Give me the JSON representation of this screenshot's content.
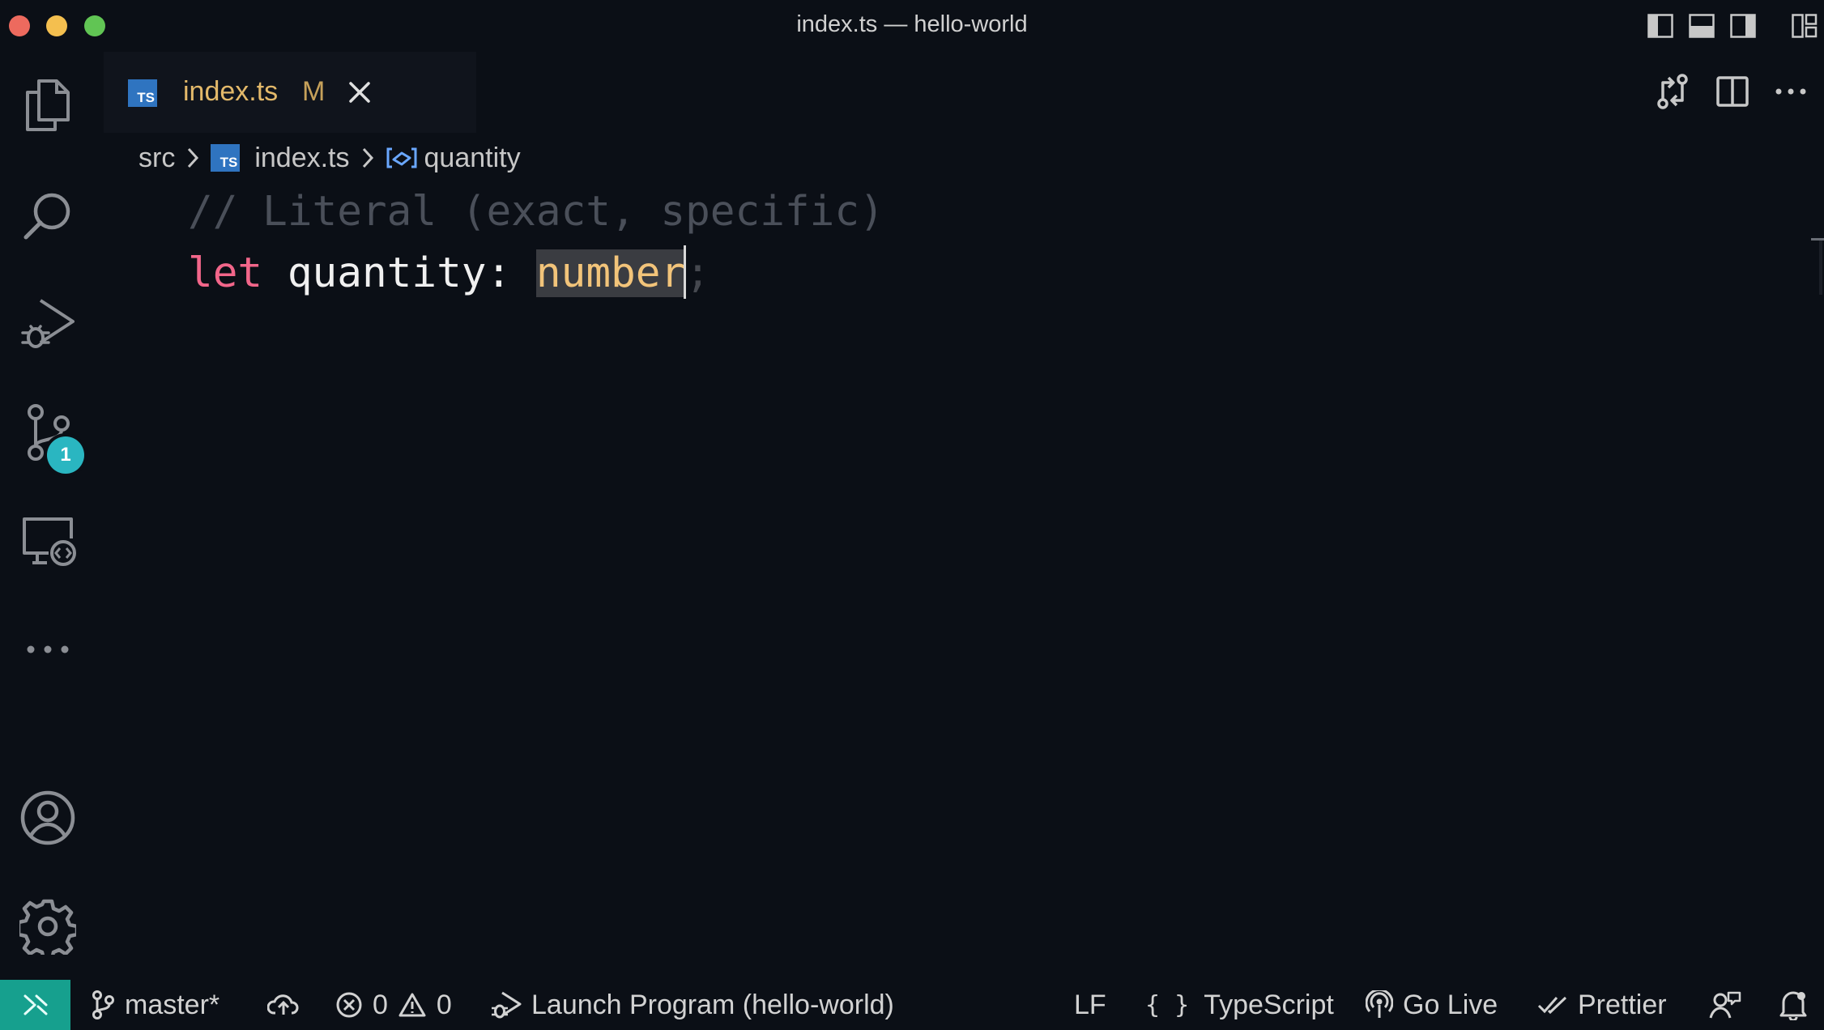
{
  "window": {
    "title": "index.ts — hello-world"
  },
  "tab": {
    "name": "index.ts",
    "modified": "M",
    "file_badge": "TS"
  },
  "breadcrumb": {
    "folder": "src",
    "file": "index.ts",
    "symbol": "quantity"
  },
  "code": {
    "comment": "// Literal (exact, specific)",
    "keyword": "let",
    "identifier": "quantity",
    "colon": ":",
    "type": "number",
    "semicolon": ";"
  },
  "activity": {
    "source_control_badge": "1"
  },
  "status": {
    "branch": "master*",
    "errors": "0",
    "warnings": "0",
    "launch": "Launch Program (hello-world)",
    "eol": "LF",
    "language": "TypeScript",
    "golive": "Go Live",
    "prettier": "Prettier"
  },
  "colors": {
    "background": "#0b0f16",
    "keyword": "#f2668a",
    "type": "#f2c47a",
    "comment": "#4a4f59",
    "remote": "#16a08e",
    "badge": "#2ab6c1"
  }
}
